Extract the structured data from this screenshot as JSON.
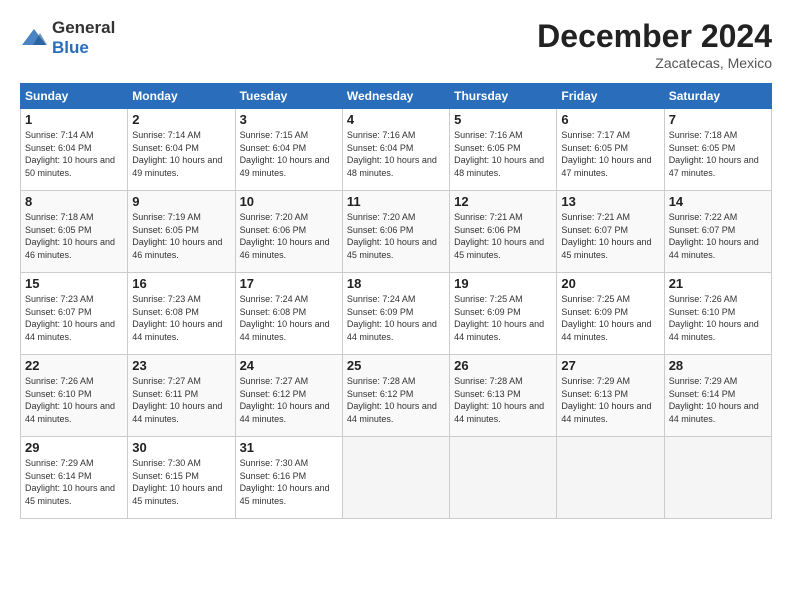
{
  "logo": {
    "general": "General",
    "blue": "Blue"
  },
  "title": "December 2024",
  "subtitle": "Zacatecas, Mexico",
  "days_of_week": [
    "Sunday",
    "Monday",
    "Tuesday",
    "Wednesday",
    "Thursday",
    "Friday",
    "Saturday"
  ],
  "weeks": [
    [
      {
        "day": "1",
        "sunrise": "7:14 AM",
        "sunset": "6:04 PM",
        "daylight": "10 hours and 50 minutes."
      },
      {
        "day": "2",
        "sunrise": "7:14 AM",
        "sunset": "6:04 PM",
        "daylight": "10 hours and 49 minutes."
      },
      {
        "day": "3",
        "sunrise": "7:15 AM",
        "sunset": "6:04 PM",
        "daylight": "10 hours and 49 minutes."
      },
      {
        "day": "4",
        "sunrise": "7:16 AM",
        "sunset": "6:04 PM",
        "daylight": "10 hours and 48 minutes."
      },
      {
        "day": "5",
        "sunrise": "7:16 AM",
        "sunset": "6:05 PM",
        "daylight": "10 hours and 48 minutes."
      },
      {
        "day": "6",
        "sunrise": "7:17 AM",
        "sunset": "6:05 PM",
        "daylight": "10 hours and 47 minutes."
      },
      {
        "day": "7",
        "sunrise": "7:18 AM",
        "sunset": "6:05 PM",
        "daylight": "10 hours and 47 minutes."
      }
    ],
    [
      {
        "day": "8",
        "sunrise": "7:18 AM",
        "sunset": "6:05 PM",
        "daylight": "10 hours and 46 minutes."
      },
      {
        "day": "9",
        "sunrise": "7:19 AM",
        "sunset": "6:05 PM",
        "daylight": "10 hours and 46 minutes."
      },
      {
        "day": "10",
        "sunrise": "7:20 AM",
        "sunset": "6:06 PM",
        "daylight": "10 hours and 46 minutes."
      },
      {
        "day": "11",
        "sunrise": "7:20 AM",
        "sunset": "6:06 PM",
        "daylight": "10 hours and 45 minutes."
      },
      {
        "day": "12",
        "sunrise": "7:21 AM",
        "sunset": "6:06 PM",
        "daylight": "10 hours and 45 minutes."
      },
      {
        "day": "13",
        "sunrise": "7:21 AM",
        "sunset": "6:07 PM",
        "daylight": "10 hours and 45 minutes."
      },
      {
        "day": "14",
        "sunrise": "7:22 AM",
        "sunset": "6:07 PM",
        "daylight": "10 hours and 44 minutes."
      }
    ],
    [
      {
        "day": "15",
        "sunrise": "7:23 AM",
        "sunset": "6:07 PM",
        "daylight": "10 hours and 44 minutes."
      },
      {
        "day": "16",
        "sunrise": "7:23 AM",
        "sunset": "6:08 PM",
        "daylight": "10 hours and 44 minutes."
      },
      {
        "day": "17",
        "sunrise": "7:24 AM",
        "sunset": "6:08 PM",
        "daylight": "10 hours and 44 minutes."
      },
      {
        "day": "18",
        "sunrise": "7:24 AM",
        "sunset": "6:09 PM",
        "daylight": "10 hours and 44 minutes."
      },
      {
        "day": "19",
        "sunrise": "7:25 AM",
        "sunset": "6:09 PM",
        "daylight": "10 hours and 44 minutes."
      },
      {
        "day": "20",
        "sunrise": "7:25 AM",
        "sunset": "6:09 PM",
        "daylight": "10 hours and 44 minutes."
      },
      {
        "day": "21",
        "sunrise": "7:26 AM",
        "sunset": "6:10 PM",
        "daylight": "10 hours and 44 minutes."
      }
    ],
    [
      {
        "day": "22",
        "sunrise": "7:26 AM",
        "sunset": "6:10 PM",
        "daylight": "10 hours and 44 minutes."
      },
      {
        "day": "23",
        "sunrise": "7:27 AM",
        "sunset": "6:11 PM",
        "daylight": "10 hours and 44 minutes."
      },
      {
        "day": "24",
        "sunrise": "7:27 AM",
        "sunset": "6:12 PM",
        "daylight": "10 hours and 44 minutes."
      },
      {
        "day": "25",
        "sunrise": "7:28 AM",
        "sunset": "6:12 PM",
        "daylight": "10 hours and 44 minutes."
      },
      {
        "day": "26",
        "sunrise": "7:28 AM",
        "sunset": "6:13 PM",
        "daylight": "10 hours and 44 minutes."
      },
      {
        "day": "27",
        "sunrise": "7:29 AM",
        "sunset": "6:13 PM",
        "daylight": "10 hours and 44 minutes."
      },
      {
        "day": "28",
        "sunrise": "7:29 AM",
        "sunset": "6:14 PM",
        "daylight": "10 hours and 44 minutes."
      }
    ],
    [
      {
        "day": "29",
        "sunrise": "7:29 AM",
        "sunset": "6:14 PM",
        "daylight": "10 hours and 45 minutes."
      },
      {
        "day": "30",
        "sunrise": "7:30 AM",
        "sunset": "6:15 PM",
        "daylight": "10 hours and 45 minutes."
      },
      {
        "day": "31",
        "sunrise": "7:30 AM",
        "sunset": "6:16 PM",
        "daylight": "10 hours and 45 minutes."
      },
      null,
      null,
      null,
      null
    ]
  ]
}
